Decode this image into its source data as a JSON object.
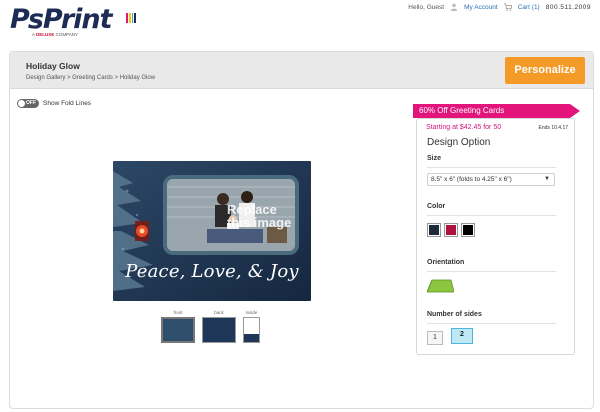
{
  "header": {
    "logo_text": "PsPrint",
    "logo_tagline_prefix": "A",
    "logo_tagline_brand": "DELUXE",
    "logo_tagline_suffix": "COMPANY",
    "greeting": "Hello, Guest",
    "my_account": "My Account",
    "cart": "Cart (1)",
    "phone": "800.511.2009"
  },
  "product": {
    "title": "Holiday Glow",
    "breadcrumb": "Design Gallery > Greeting Cards > Holiday Glow",
    "personalize_label": "Personalize"
  },
  "fold_toggle": {
    "state": "OFF",
    "label": "Show Fold Lines"
  },
  "card": {
    "greeting": "Peace, Love, & Joy",
    "placeholder_text": "Replace this image",
    "background_color": "#1c3350"
  },
  "thumbnails": [
    {
      "label": "front"
    },
    {
      "label": "back"
    },
    {
      "label": "inside"
    }
  ],
  "promo": {
    "banner": "60% Off Greeting Cards",
    "starting": "Starting at $42.45 for 50",
    "ends": "Ends 10.4.17",
    "color": "#e3157d"
  },
  "design_options": {
    "title": "Design Option",
    "size_label": "Size",
    "size_value": "8.5\" x 6\" (folds to 4.25\" x 6\")",
    "color_label": "Color",
    "colors": [
      "#1c2a3a",
      "#b0123e",
      "#000000"
    ],
    "orientation_label": "Orientation",
    "orientation_value": "landscape",
    "sides_label": "Number of sides",
    "sides_options": [
      "1",
      "2"
    ],
    "sides_selected": "2"
  },
  "colors": {
    "accent": "#f39b26",
    "link": "#2a6fb0"
  }
}
